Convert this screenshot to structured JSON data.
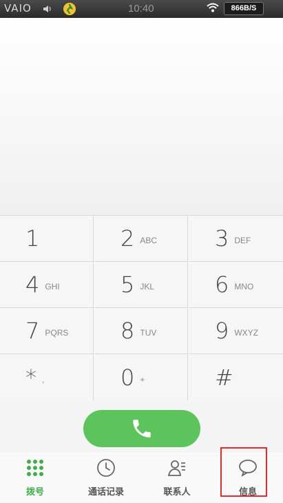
{
  "status_bar": {
    "brand": "VAIO",
    "time": "10:40",
    "net_speed": "866B/S"
  },
  "keypad": {
    "keys": [
      {
        "digit": "1",
        "letters": ""
      },
      {
        "digit": "2",
        "letters": "ABC"
      },
      {
        "digit": "3",
        "letters": "DEF"
      },
      {
        "digit": "4",
        "letters": "GHI"
      },
      {
        "digit": "5",
        "letters": "JKL"
      },
      {
        "digit": "6",
        "letters": "MNO"
      },
      {
        "digit": "7",
        "letters": "PQRS"
      },
      {
        "digit": "8",
        "letters": "TUV"
      },
      {
        "digit": "9",
        "letters": "WXYZ"
      },
      {
        "digit": "*",
        "letters": ","
      },
      {
        "digit": "0",
        "letters": "+"
      },
      {
        "digit": "#",
        "letters": ""
      }
    ]
  },
  "call_button": {
    "icon": "phone-icon"
  },
  "bottom_nav": {
    "items": [
      {
        "label": "拨号",
        "icon": "dialpad-icon",
        "active": true
      },
      {
        "label": "通话记录",
        "icon": "clock-icon",
        "active": false
      },
      {
        "label": "联系人",
        "icon": "contacts-icon",
        "active": false
      },
      {
        "label": "信息",
        "icon": "message-icon",
        "active": false
      }
    ]
  },
  "colors": {
    "accent": "#5cc35d",
    "active_tab": "#3fae4a",
    "highlight": "#e42b2b"
  }
}
